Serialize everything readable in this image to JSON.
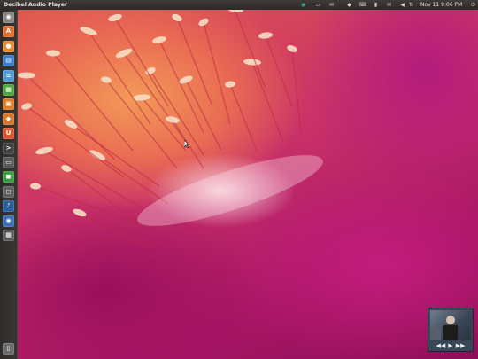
{
  "top_panel": {
    "app_title": "Decibel Audio Player",
    "clock": "Nov 11 9:06 PM",
    "indicators": [
      "ubuntu-one-icon",
      "window-icon",
      "chat-icon",
      "dropbox-icon",
      "keyboard-icon",
      "battery-icon",
      "mail-icon",
      "volume-icon",
      "network-icon",
      "power-icon"
    ]
  },
  "launcher": {
    "items": [
      {
        "name": "dash-home-icon",
        "color": "#8a8580",
        "glyph": "◉"
      },
      {
        "name": "ubuntu-software-icon",
        "color": "#e06b2d",
        "glyph": "A"
      },
      {
        "name": "firefox-icon",
        "color": "#e4882e",
        "glyph": "●"
      },
      {
        "name": "files-icon",
        "color": "#3a7ecb",
        "glyph": "▤"
      },
      {
        "name": "document-icon",
        "color": "#4f9bd8",
        "glyph": "≡"
      },
      {
        "name": "spreadsheet-icon",
        "color": "#4ea53a",
        "glyph": "▦"
      },
      {
        "name": "presentation-icon",
        "color": "#e07b28",
        "glyph": "▣"
      },
      {
        "name": "software-center-icon",
        "color": "#d8772a",
        "glyph": "◆"
      },
      {
        "name": "ubuntu-one-launcher-icon",
        "color": "#d8552f",
        "glyph": "U"
      },
      {
        "name": "terminal-icon",
        "color": "#404040",
        "glyph": ">"
      },
      {
        "name": "monitor-icon",
        "color": "#5a5a5a",
        "glyph": "▭"
      },
      {
        "name": "app-green-icon",
        "color": "#3d9a3d",
        "glyph": "◼"
      },
      {
        "name": "app-grey-icon",
        "color": "#606060",
        "glyph": "◻"
      },
      {
        "name": "audio-player-icon",
        "color": "#2d5e9c",
        "glyph": "♪"
      },
      {
        "name": "app-blue-icon",
        "color": "#3b6fb5",
        "glyph": "◉"
      },
      {
        "name": "workspace-switcher-icon",
        "color": "#5a5a5a",
        "glyph": "▦"
      }
    ],
    "trash": {
      "name": "trash-icon",
      "glyph": "▯"
    }
  },
  "mini_player": {
    "controls": [
      "previous-icon",
      "play-icon",
      "next-icon"
    ],
    "glyphs": [
      "◀◀",
      "▶",
      "▶▶"
    ]
  },
  "colors": {
    "panel": "#2f2d2a",
    "wallpaper_orange": "#f29a58",
    "wallpaper_magenta": "#b0145c"
  }
}
